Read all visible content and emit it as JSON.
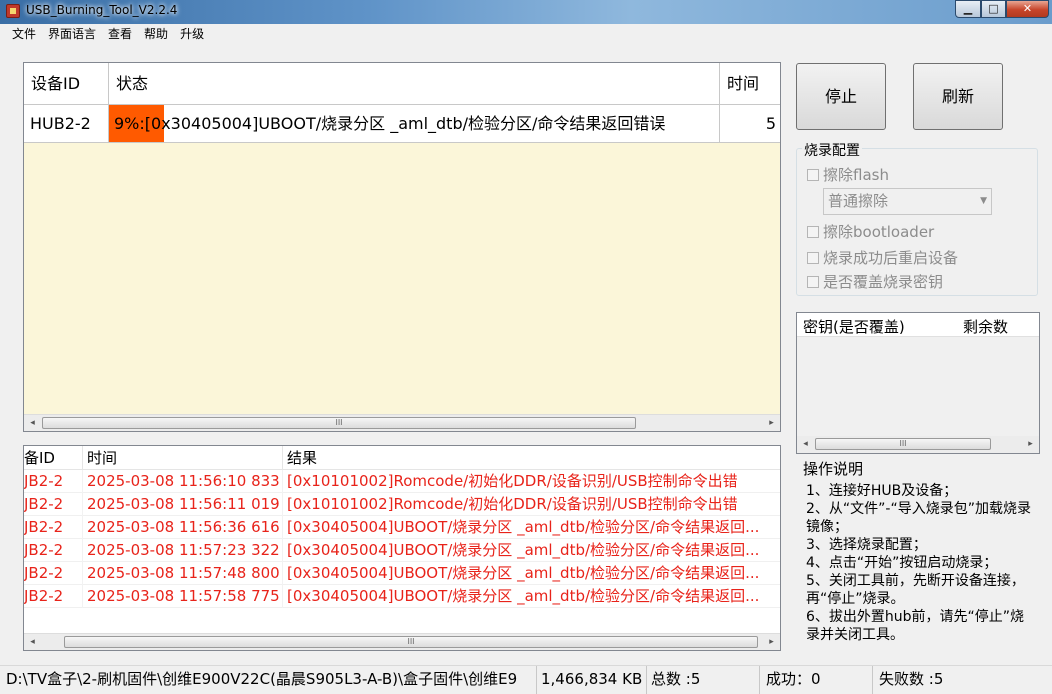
{
  "window": {
    "title": "USB_Burning_Tool_V2.2.4",
    "min": "▁",
    "max": "□",
    "close": "✕"
  },
  "menu": [
    "文件",
    "界面语言",
    "查看",
    "帮助",
    "升级"
  ],
  "device_table": {
    "columns": [
      "设备ID",
      "状态",
      "时间"
    ],
    "rows": [
      {
        "id": "HUB2-2",
        "status": "9%:[0x30405004]UBOOT/烧录分区 _aml_dtb/检验分区/命令结果返回错误",
        "progress_percent": 9,
        "time": "5"
      }
    ]
  },
  "buttons": {
    "stop": "停止",
    "refresh": "刷新"
  },
  "burn_config": {
    "title": "烧录配置",
    "erase_flash": "擦除flash",
    "erase_mode": "普通擦除",
    "erase_bootloader": "擦除bootloader",
    "reboot_after": "烧录成功后重启设备",
    "overwrite_key": "是否覆盖烧录密钥"
  },
  "key_list": {
    "columns": [
      "密钥(是否覆盖)",
      "剩余数"
    ]
  },
  "instructions": {
    "title": "操作说明",
    "lines": [
      "1、连接好HUB及设备；",
      "2、从“文件”-“导入烧录包”加载烧录镜像；",
      "3、选择烧录配置；",
      "4、点击“开始”按钮启动烧录；",
      "5、关闭工具前，先断开设备连接，再“停止”烧录。",
      "6、拔出外置hub前，请先“停止”烧录并关闭工具。"
    ]
  },
  "log": {
    "columns": [
      "备ID",
      "时间",
      "结果"
    ],
    "rows": [
      {
        "id": "JB2-2",
        "time": "2025-03-08 11:56:10 833",
        "result": "[0x10101002]Romcode/初始化DDR/设备识别/USB控制命令出错"
      },
      {
        "id": "JB2-2",
        "time": "2025-03-08 11:56:11 019",
        "result": "[0x10101002]Romcode/初始化DDR/设备识别/USB控制命令出错"
      },
      {
        "id": "JB2-2",
        "time": "2025-03-08 11:56:36 616",
        "result": "[0x30405004]UBOOT/烧录分区 _aml_dtb/检验分区/命令结果返回..."
      },
      {
        "id": "JB2-2",
        "time": "2025-03-08 11:57:23 322",
        "result": "[0x30405004]UBOOT/烧录分区 _aml_dtb/检验分区/命令结果返回..."
      },
      {
        "id": "JB2-2",
        "time": "2025-03-08 11:57:48 800",
        "result": "[0x30405004]UBOOT/烧录分区 _aml_dtb/检验分区/命令结果返回..."
      },
      {
        "id": "JB2-2",
        "time": "2025-03-08 11:57:58 775",
        "result": "[0x30405004]UBOOT/烧录分区 _aml_dtb/检验分区/命令结果返回..."
      }
    ]
  },
  "statusbar": {
    "path": "D:\\TV盒子\\2-刷机固件\\创维E900V22C(晶晨S905L3-A-B)\\盒子固件\\创维E9",
    "size": "1,466,834 KB",
    "total": "总数 :5",
    "success": "成功：0",
    "fail": "失败数 :5"
  },
  "colors": {
    "progress": "#ff5a00",
    "log_text": "#e8231a",
    "grid_bg": "#fbf6d9"
  },
  "scroll_glyph": "III"
}
